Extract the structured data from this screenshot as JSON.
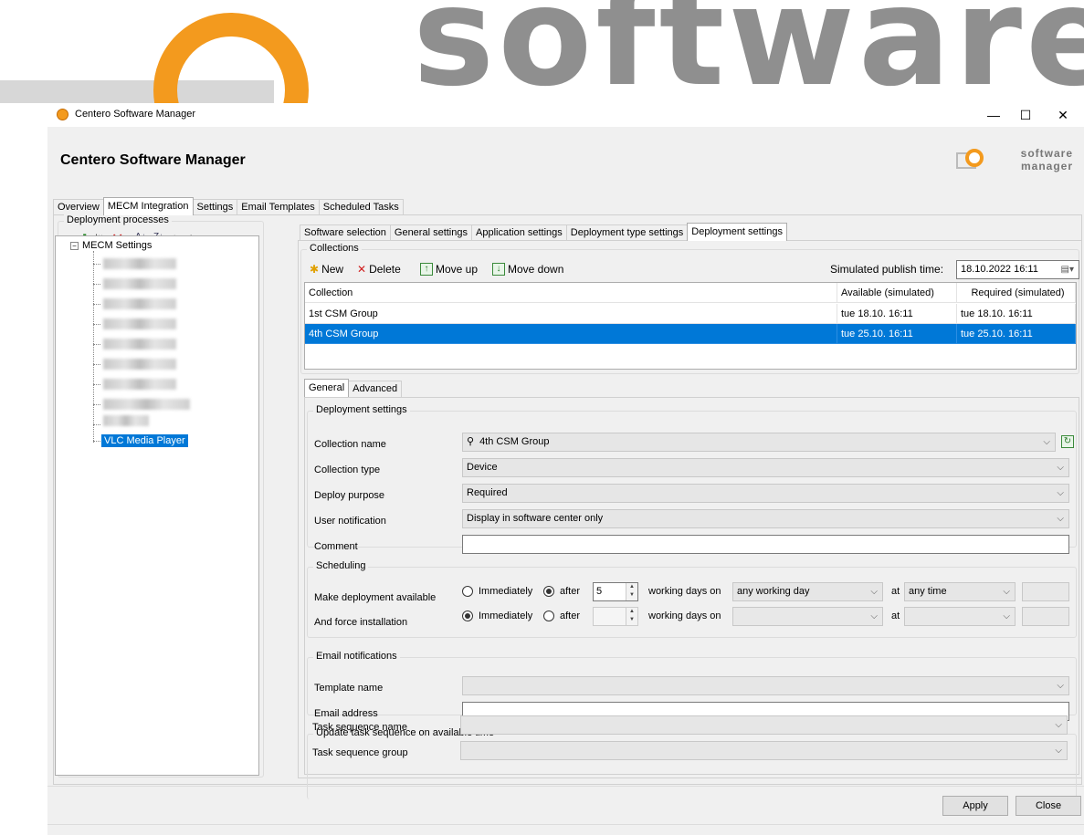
{
  "window": {
    "title": "Centero Software Manager",
    "app_title": "Centero Software Manager",
    "logo_text_line1": "software",
    "logo_text_line2": "manager",
    "minimize": "—",
    "maximize": "☐",
    "close": "✕"
  },
  "banner": {
    "word": "software"
  },
  "main_tabs": [
    "Overview",
    "MECM Integration",
    "Settings",
    "Email Templates",
    "Scheduled Tasks"
  ],
  "left": {
    "group_title": "Deployment processes",
    "tree_root": "MECM Settings",
    "selected_item": "VLC Media Player"
  },
  "sub_tabs": [
    "Software selection",
    "General settings",
    "Application settings",
    "Deployment type settings",
    "Deployment settings"
  ],
  "collections": {
    "group_title": "Collections",
    "toolbar": {
      "new": "New",
      "delete": "Delete",
      "move_up": "Move up",
      "move_down": "Move down"
    },
    "simulated_label": "Simulated publish time:",
    "simulated_value": "18.10.2022 16:11",
    "columns": [
      "Collection",
      "Available (simulated)",
      "Required (simulated)"
    ],
    "rows": [
      [
        "1st CSM Group",
        "tue 18.10. 16:11",
        "tue 18.10. 16:11"
      ],
      [
        "4th CSM Group",
        "tue 25.10. 16:11",
        "tue 25.10. 16:11"
      ]
    ]
  },
  "detail_tabs": [
    "General",
    "Advanced"
  ],
  "deployment": {
    "group_title": "Deployment settings",
    "collection_name_label": "Collection name",
    "collection_name_value": "4th CSM Group",
    "collection_type_label": "Collection type",
    "collection_type_value": "Device",
    "deploy_purpose_label": "Deploy purpose",
    "deploy_purpose_value": "Required",
    "user_notification_label": "User notification",
    "user_notification_value": "Display in software center only",
    "comment_label": "Comment",
    "comment_value": ""
  },
  "scheduling": {
    "group_title": "Scheduling",
    "available_label": "Make deployment available",
    "force_label": "And force installation",
    "immediately": "Immediately",
    "after": "after",
    "available_days": "5",
    "working_days_on": "working days on",
    "available_day_option": "any working day",
    "at": "at",
    "available_time_option": "any time"
  },
  "email": {
    "group_title": "Email notifications",
    "template_label": "Template name",
    "address_label": "Email address"
  },
  "task_sequence": {
    "group_title": "Update task sequence on available time",
    "name_label": "Task sequence name",
    "group_label": "Task sequence group"
  },
  "footer": {
    "apply": "Apply",
    "close": "Close"
  }
}
